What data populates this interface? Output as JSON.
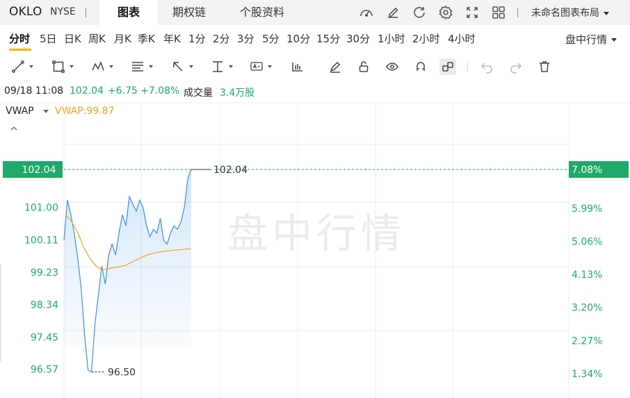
{
  "header": {
    "symbol": "OKLO",
    "exchange": "NYSE",
    "tabs": [
      "图表",
      "期权链",
      "个股资料"
    ],
    "active_tab": 0,
    "icons": [
      "speedometer-icon",
      "edit-icon",
      "refresh-icon",
      "settings-icon",
      "fullscreen-icon",
      "grid-layout-icon"
    ],
    "layout_label": "未命名图表布局"
  },
  "periods": {
    "items": [
      "分时",
      "5日",
      "日K",
      "周K",
      "月K",
      "季K",
      "年K",
      "1分",
      "2分",
      "3分",
      "5分",
      "10分",
      "15分",
      "30分",
      "1小时",
      "2小时",
      "4小时"
    ],
    "active": 0,
    "mode_label": "盘中行情"
  },
  "toolbar": {
    "tools": [
      "trend-line-icon",
      "rectangle-icon",
      "pattern-icon",
      "fib-lines-icon",
      "arrow-icon",
      "measure-icon",
      "text-note-icon",
      "candle-bars-icon",
      "pencil-icon",
      "lock-icon",
      "eye-icon",
      "magnet-icon",
      "link-icon",
      "undo-icon",
      "redo-icon",
      "delete-icon"
    ]
  },
  "quote": {
    "datetime": "09/18 11:08",
    "price": "102.04",
    "change": "+6.75",
    "change_pct": "+7.08%",
    "volume_label": "成交量",
    "volume": "3.4万股"
  },
  "indicator": {
    "name": "VWAP",
    "value_text": "VWAP:99.87"
  },
  "colors": {
    "up": "#1eaa6a",
    "price_line": "#3b8fe0",
    "vwap_line": "#f0a020",
    "grid": "#ececec"
  },
  "chart_data": {
    "type": "line",
    "y_ticks": [
      "101.00",
      "100.11",
      "99.23",
      "98.34",
      "97.45",
      "96.57"
    ],
    "y_tick_values": [
      101.0,
      100.11,
      99.23,
      98.34,
      97.45,
      96.57
    ],
    "pct_ticks": [
      "7.08%",
      "5.99%",
      "5.06%",
      "4.13%",
      "3.20%",
      "2.27%",
      "1.34%"
    ],
    "pct_tick_values": [
      7.08,
      5.99,
      5.06,
      4.13,
      3.2,
      2.27,
      1.34
    ],
    "last_price_label": "102.04",
    "last_price": 102.04,
    "high_label": "102.04",
    "low_label": "96.50",
    "low": 96.5,
    "ylim": [
      96.45,
      102.04
    ],
    "series": [
      {
        "name": "price",
        "values": [
          100.1,
          101.2,
          100.8,
          100.3,
          99.6,
          98.8,
          97.5,
          96.55,
          96.5,
          97.8,
          98.6,
          99.4,
          98.9,
          99.7,
          100.0,
          99.7,
          100.3,
          100.8,
          100.5,
          101.3,
          101.1,
          100.9,
          101.2,
          101.0,
          100.5,
          100.2,
          100.4,
          100.3,
          100.7,
          100.1,
          100.0,
          100.3,
          100.5,
          100.4,
          100.6,
          101.0,
          101.8,
          102.04
        ]
      },
      {
        "name": "VWAP",
        "values": [
          100.8,
          100.6,
          100.3,
          99.9,
          99.6,
          99.4,
          99.3,
          99.32,
          99.35,
          99.38,
          99.42,
          99.5,
          99.58,
          99.66,
          99.72,
          99.76,
          99.79,
          99.81,
          99.83,
          99.84,
          99.86,
          99.87
        ]
      }
    ]
  },
  "watermark": "盘中行情"
}
